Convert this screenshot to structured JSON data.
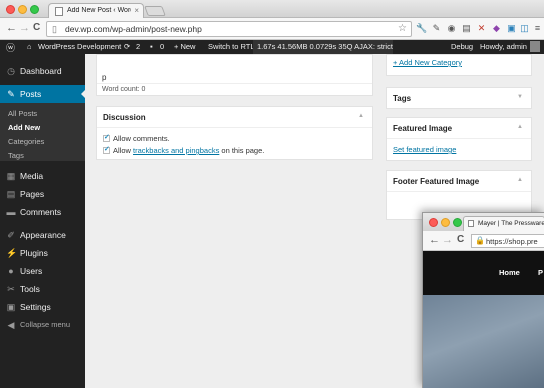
{
  "browser": {
    "tab_title": "Add New Post ‹ WordPress",
    "tab_close": "×",
    "url": "dev.wp.com/wp-admin/post-new.php",
    "nav": {
      "back": "←",
      "forward": "→",
      "reload": "C"
    },
    "star": "☆",
    "extensions": [
      "🔧",
      "✎",
      "◉",
      "▤",
      "✕",
      "◆",
      "▣",
      "◫",
      "≡"
    ]
  },
  "adminbar": {
    "site_name": "WordPress Development",
    "updates_count": "2",
    "comments_count": "0",
    "new_label": "+ New",
    "switch_rtl": "Switch to RTL",
    "perf": "1.67s  41.56MB  0.0729s  35Q  AJAX: strict",
    "debug": "Debug",
    "howdy": "Howdy, admin"
  },
  "sidebar": {
    "items": [
      {
        "label": "Dashboard",
        "icon": "dashboard-icon"
      },
      {
        "label": "Posts",
        "icon": "pin-icon"
      },
      {
        "label": "Media",
        "icon": "media-icon"
      },
      {
        "label": "Pages",
        "icon": "pages-icon"
      },
      {
        "label": "Comments",
        "icon": "comments-icon"
      },
      {
        "label": "Appearance",
        "icon": "brush-icon"
      },
      {
        "label": "Plugins",
        "icon": "plug-icon"
      },
      {
        "label": "Users",
        "icon": "user-icon"
      },
      {
        "label": "Tools",
        "icon": "wrench-icon"
      },
      {
        "label": "Settings",
        "icon": "settings-icon"
      },
      {
        "label": "Collapse menu",
        "icon": "collapse-icon"
      }
    ],
    "posts_submenu": [
      "All Posts",
      "Add New",
      "Categories",
      "Tags"
    ]
  },
  "editor": {
    "path": "p",
    "word_count": "Word count: 0"
  },
  "discussion": {
    "title": "Discussion",
    "allow_comments": "Allow comments.",
    "allow_prefix": "Allow ",
    "trackbacks_link": "trackbacks and pingbacks",
    "allow_suffix": " on this page."
  },
  "side": {
    "add_category": "+ Add New Category",
    "tags_title": "Tags",
    "featured_image_title": "Featured Image",
    "set_featured_image": "Set featured image",
    "footer_featured_title": "Footer Featured Image"
  },
  "popup": {
    "tab_title": "Mayer | The Pressware",
    "url": "https://shop.pre",
    "nav_home": "Home",
    "nav_next": "P"
  },
  "colors": {
    "accent": "#0074a2",
    "adminbar": "#222222",
    "sidebar": "#222222"
  }
}
